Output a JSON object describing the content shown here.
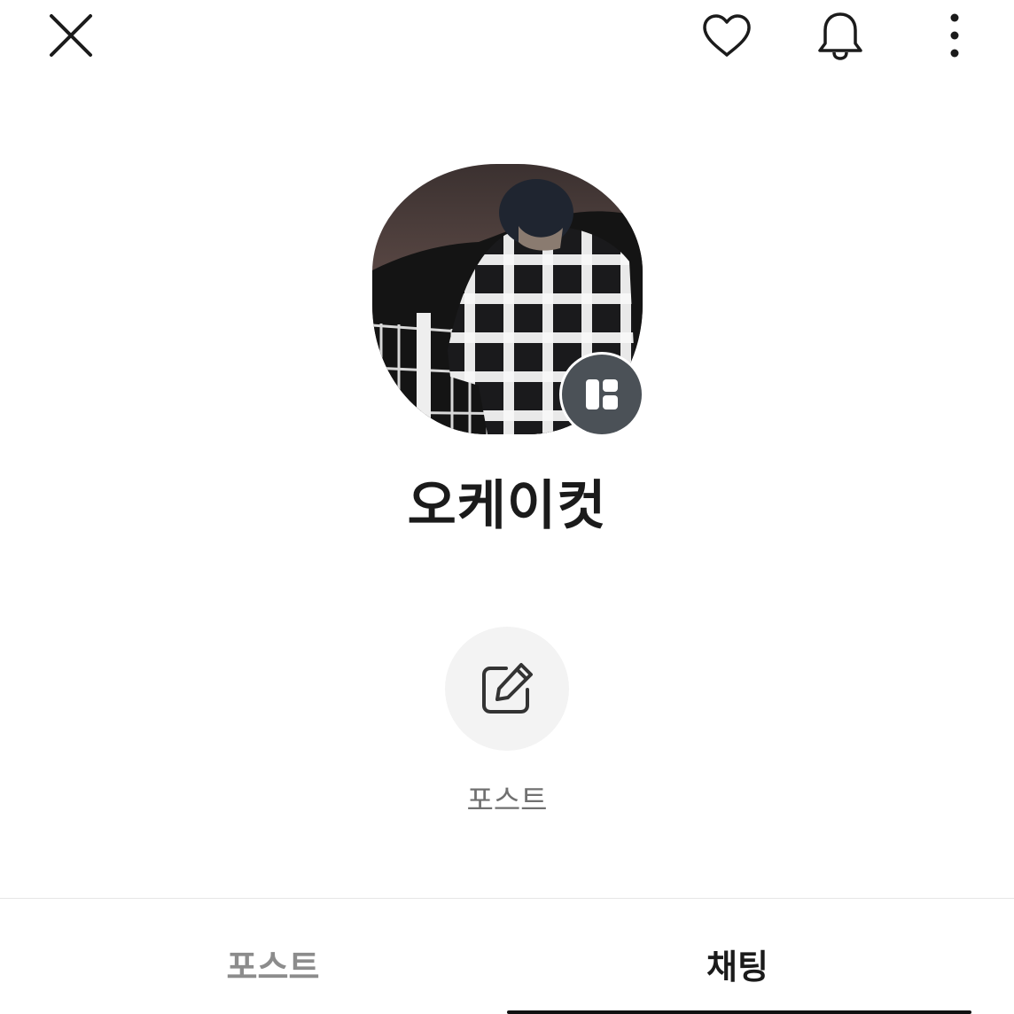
{
  "header": {
    "close_icon": "close-icon",
    "like_icon": "heart-icon",
    "notify_icon": "bell-icon",
    "more_icon": "more-vertical-icon"
  },
  "profile": {
    "name": "오케이컷",
    "badge_icon": "channel-badge-icon"
  },
  "actions": [
    {
      "label": "포스트",
      "icon": "edit-icon"
    }
  ],
  "tabs": [
    {
      "label": "포스트",
      "active": false
    },
    {
      "label": "채팅",
      "active": true
    }
  ],
  "colors": {
    "badge": "#4b5157",
    "action_bg": "#f3f3f3",
    "active_tab": "#1b1b1b",
    "inactive_tab": "#8c8c8c"
  }
}
